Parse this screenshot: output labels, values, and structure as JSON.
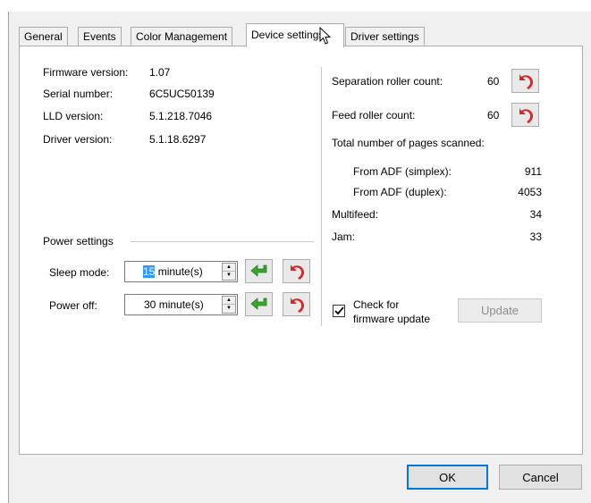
{
  "tabs": [
    {
      "label": "General"
    },
    {
      "label": "Events"
    },
    {
      "label": "Color Management"
    },
    {
      "label": "Device settings",
      "active": true
    },
    {
      "label": "Driver settings"
    }
  ],
  "device_info": {
    "firmware_label": "Firmware version:",
    "firmware_value": "1.07",
    "serial_label": "Serial number:",
    "serial_value": "6C5UC50139",
    "lld_label": "LLD version:",
    "lld_value": "5.1.218.7046",
    "driver_label": "Driver version:",
    "driver_value": "5.1.18.6297"
  },
  "power": {
    "group_label": "Power settings",
    "sleep_label": "Sleep mode:",
    "sleep_value": "15",
    "sleep_unit": "minute(s)",
    "off_label": "Power off:",
    "off_value": "30",
    "off_unit": "minute(s)",
    "accept_icon": "green-enter-arrow-icon",
    "reset_icon": "red-undo-arrow-icon"
  },
  "counters": {
    "separation_label": "Separation roller count:",
    "separation_value": "60",
    "feed_label": "Feed roller count:",
    "feed_value": "60",
    "total_label": "Total number of pages scanned:",
    "simplex_label": "From ADF (simplex):",
    "simplex_value": "911",
    "duplex_label": "From ADF (duplex):",
    "duplex_value": "4053",
    "multifeed_label": "Multifeed:",
    "multifeed_value": "34",
    "jam_label": "Jam:",
    "jam_value": "33"
  },
  "firmware_check": {
    "checked": true,
    "label_line1": "Check for",
    "label_line2": "firmware update",
    "update_label": "Update"
  },
  "footer": {
    "ok_label": "OK",
    "cancel_label": "Cancel"
  },
  "colors": {
    "accept_green": "#3aa62e",
    "reset_red": "#d9262a",
    "default_button_border": "#0078d7"
  }
}
